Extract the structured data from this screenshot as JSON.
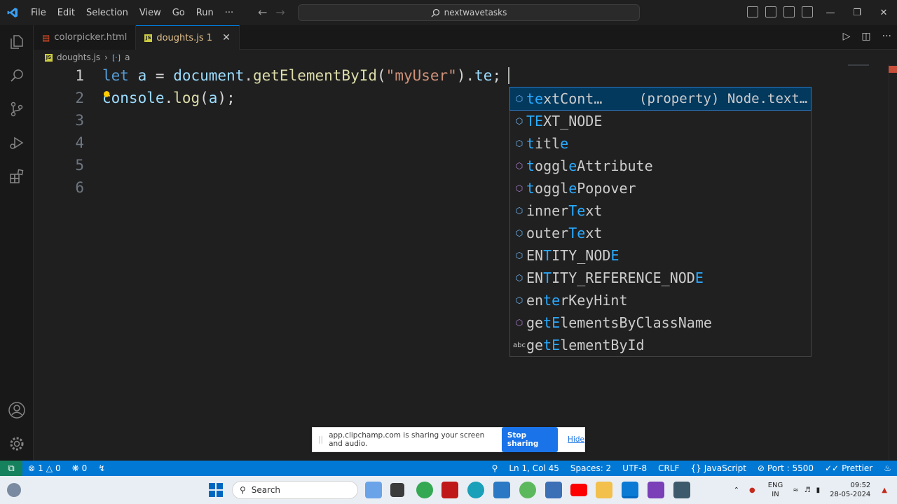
{
  "titlebar": {
    "menu": [
      "File",
      "Edit",
      "Selection",
      "View",
      "Go",
      "Run",
      "···"
    ],
    "search_text": "nextwavetasks"
  },
  "tabs": [
    {
      "label": "colorpicker.html",
      "icon": "html-icon",
      "active": false
    },
    {
      "label": "doughts.js 1",
      "icon": "js-icon",
      "active": true
    }
  ],
  "breadcrumb": {
    "file": "doughts.js",
    "symbol": "a"
  },
  "editor": {
    "line_numbers": [
      "1",
      "2",
      "3",
      "4",
      "5",
      "6"
    ],
    "line1": {
      "kw": "let",
      "var": "a",
      "eq": " = ",
      "obj": "document",
      "dot1": ".",
      "fn": "getElementById",
      "lp": "(",
      "str": "\"myUser\"",
      "rp": ")",
      "dot2": ".",
      "prop": "te",
      "semi": ";"
    },
    "line2": {
      "obj": "console",
      "dot": ".",
      "fn": "log",
      "lp": "(",
      "arg": "a",
      "rp": ");"
    }
  },
  "suggestions": [
    {
      "pre": "",
      "hl": "te",
      "post": "xtCont…",
      "detail": "(property) Node.text…",
      "icon": "property-icon"
    },
    {
      "pre": "",
      "hl": "TE",
      "post": "XT_NODE",
      "icon": "property-icon"
    },
    {
      "pre": "",
      "hl": "t",
      "post": "itl",
      "hl2": "e",
      "icon": "property-icon"
    },
    {
      "pre": "",
      "hl": "t",
      "post": "oggl",
      "hl2": "e",
      "post2": "Attribute",
      "icon": "method-icon"
    },
    {
      "pre": "",
      "hl": "t",
      "post": "oggl",
      "hl2": "e",
      "post2": "Popover",
      "icon": "method-icon"
    },
    {
      "pre": "inner",
      "hl": "Te",
      "post": "xt",
      "icon": "property-icon"
    },
    {
      "pre": "outer",
      "hl": "Te",
      "post": "xt",
      "icon": "property-icon"
    },
    {
      "pre": "EN",
      "hl": "T",
      "post": "ITY_NOD",
      "hl2": "E",
      "icon": "property-icon"
    },
    {
      "pre": "EN",
      "hl": "T",
      "post": "ITY_REFERENCE_NOD",
      "hl2": "E",
      "icon": "property-icon"
    },
    {
      "pre": "en",
      "hl": "te",
      "post": "rKeyHint",
      "icon": "property-icon"
    },
    {
      "pre": "ge",
      "hl": "tE",
      "post": "lementsByClassName",
      "icon": "method-icon"
    },
    {
      "pre": "ge",
      "hl": "tE",
      "post": "lementById",
      "icon": "abc-icon"
    }
  ],
  "share_banner": {
    "message": "app.clipchamp.com is sharing your screen and audio.",
    "stop_label": "Stop sharing",
    "hide_label": "Hide"
  },
  "statusbar": {
    "errors": "1",
    "warnings": "0",
    "ports": "0",
    "position": "Ln 1, Col 45",
    "spaces": "Spaces: 2",
    "encoding": "UTF-8",
    "eol": "CRLF",
    "language": "JavaScript",
    "port": "Port : 5500",
    "formatter": "Prettier"
  },
  "taskbar": {
    "search_label": "Search",
    "lang_line1": "ENG",
    "lang_line2": "IN",
    "time": "09:52",
    "date": "28-05-2024"
  },
  "colors": {
    "accent": "#0078d4",
    "status_remote": "#16825d",
    "highlight": "#2aaaff"
  }
}
